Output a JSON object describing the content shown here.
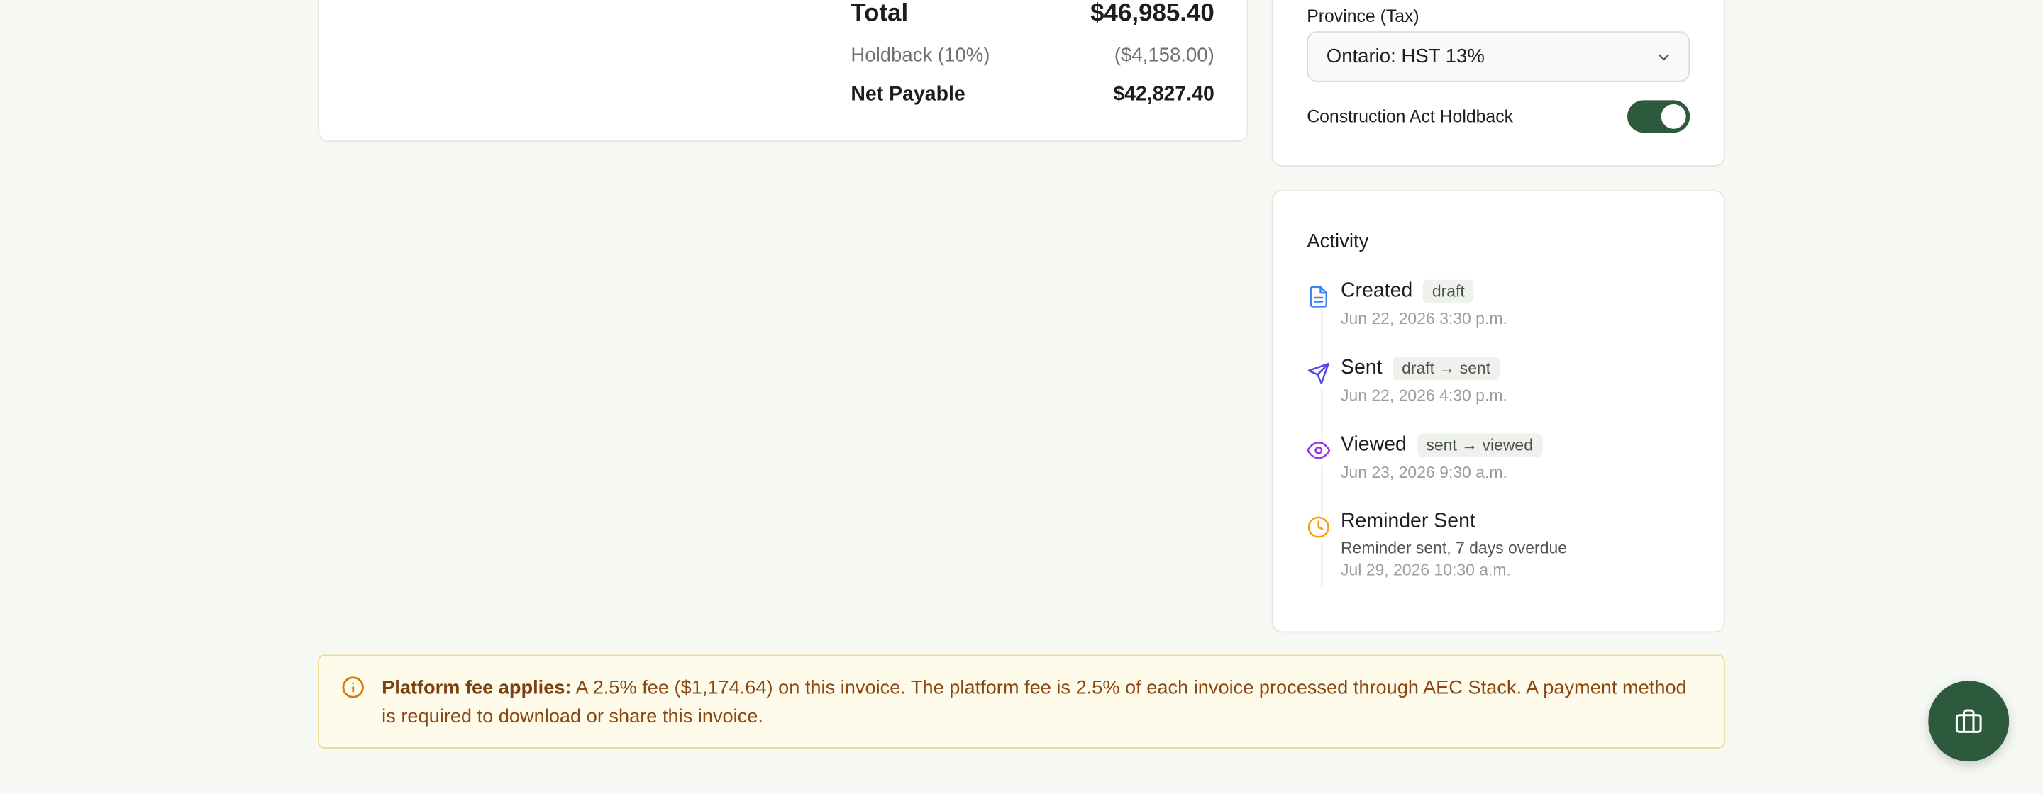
{
  "totals": {
    "total_label": "Total",
    "total_value": "$46,985.40",
    "holdback_label": "Holdback (10%)",
    "holdback_value": "($4,158.00)",
    "net_label": "Net Payable",
    "net_value": "$42,827.40"
  },
  "settings": {
    "province_label": "Province (Tax)",
    "province_value": "Ontario: HST 13%",
    "holdback_toggle_label": "Construction Act Holdback",
    "holdback_toggle_on": true
  },
  "activity": {
    "title": "Activity",
    "items": [
      {
        "name": "Created",
        "badge": "draft",
        "time": "Jun 22, 2026 3:30 p.m.",
        "icon": "document-icon",
        "color": "#3b82f6"
      },
      {
        "name": "Sent",
        "badge": "draft → sent",
        "time": "Jun 22, 2026 4:30 p.m.",
        "icon": "send-icon",
        "color": "#4f46e5"
      },
      {
        "name": "Viewed",
        "badge": "sent → viewed",
        "time": "Jun 23, 2026 9:30 a.m.",
        "icon": "eye-icon",
        "color": "#9333ea"
      },
      {
        "name": "Reminder Sent",
        "note": "Reminder sent, 7 days overdue",
        "time": "Jul 29, 2026 10:30 a.m.",
        "icon": "clock-icon",
        "color": "#f59e0b"
      }
    ]
  },
  "banner": {
    "title": "Platform fee applies:",
    "message": "A 2.5% fee ($1,174.64) on this invoice. The platform fee is 2.5% of each invoice processed through AEC Stack. A payment method is required to download or share this invoice.",
    "icon": "info-icon"
  },
  "fab": {
    "icon": "briefcase-icon"
  },
  "colors": {
    "accent": "#2d5a3c",
    "background": "#f6f8f3",
    "warning_bg": "#fffbea",
    "warning_text": "#8a4712"
  }
}
